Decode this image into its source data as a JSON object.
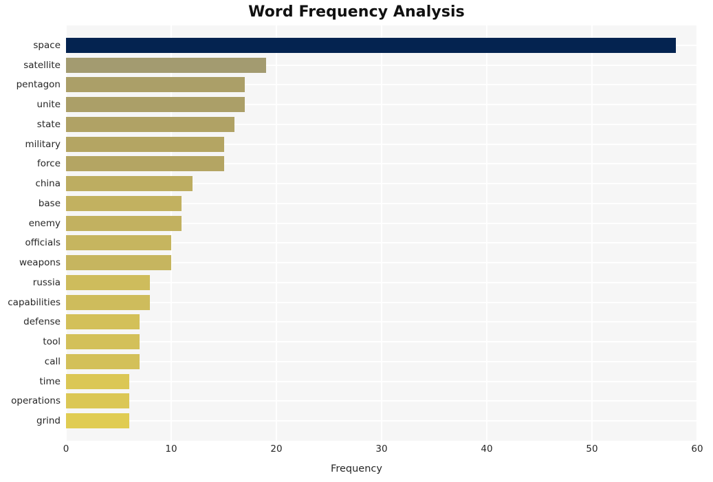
{
  "chart_data": {
    "type": "bar",
    "orientation": "horizontal",
    "title": "Word Frequency Analysis",
    "xlabel": "Frequency",
    "ylabel": "",
    "xlim": [
      0,
      60
    ],
    "xticks": [
      0,
      10,
      20,
      30,
      40,
      50,
      60
    ],
    "grid": true,
    "legend": "none",
    "categories": [
      "space",
      "satellite",
      "pentagon",
      "unite",
      "state",
      "military",
      "force",
      "china",
      "base",
      "enemy",
      "officials",
      "weapons",
      "russia",
      "capabilities",
      "defense",
      "tool",
      "call",
      "time",
      "operations",
      "grind"
    ],
    "values": [
      58,
      19,
      17,
      17,
      16,
      15,
      15,
      12,
      11,
      11,
      10,
      10,
      8,
      8,
      7,
      7,
      7,
      6,
      6,
      6
    ],
    "bar_colors": [
      "#042350",
      "#a39b70",
      "#ab9f68",
      "#ab9f68",
      "#b0a265",
      "#b4a563",
      "#b4a563",
      "#bdad61",
      "#c2b160",
      "#c2b160",
      "#c6b55f",
      "#c6b55f",
      "#cebc5c",
      "#cebc5c",
      "#d3c059",
      "#d3c059",
      "#d3c059",
      "#dbc755",
      "#dbc755",
      "#e0cc52"
    ],
    "plot_background": "#f6f6f6",
    "grid_color": "#ffffff",
    "text_color": "#262626"
  }
}
